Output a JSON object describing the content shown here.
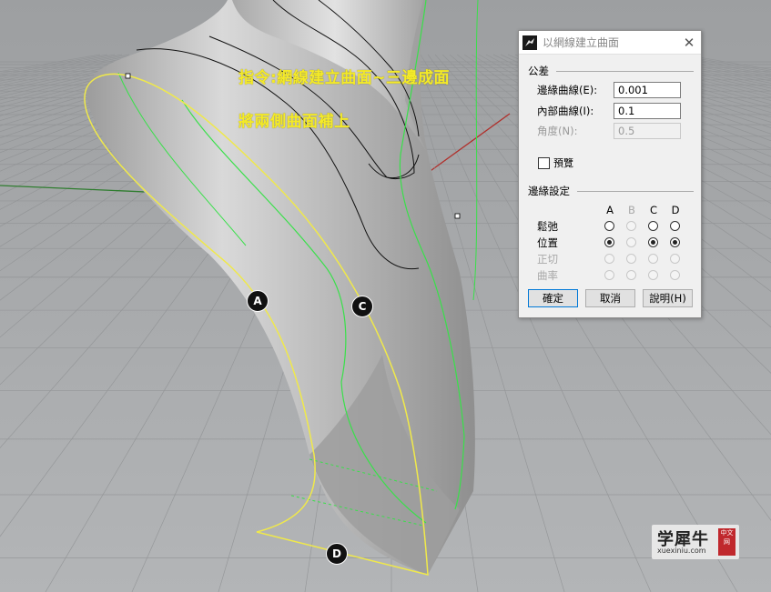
{
  "annotations": {
    "command_line": "指令:網線建立曲面~三邊成面",
    "instruction": "將兩側曲面補上"
  },
  "markers": [
    "A",
    "C",
    "D"
  ],
  "dialog": {
    "title": "以網線建立曲面",
    "close_icon": "close-icon",
    "tolerance": {
      "heading": "公差",
      "edge_label": "邊緣曲線(E):",
      "edge_value": "0.001",
      "interior_label": "內部曲線(I):",
      "interior_value": "0.1",
      "angle_label": "角度(N):",
      "angle_value": "0.5"
    },
    "preview_label": "預覽",
    "preview_checked": false,
    "edge_settings": {
      "heading": "邊緣設定",
      "columns": [
        "A",
        "B",
        "C",
        "D"
      ],
      "rows": [
        {
          "label": "鬆弛",
          "enabled": true
        },
        {
          "label": "位置",
          "enabled": true
        },
        {
          "label": "正切",
          "enabled": false
        },
        {
          "label": "曲率",
          "enabled": false
        }
      ],
      "selected": {
        "A": "位置",
        "B": null,
        "C": "位置",
        "D": "位置"
      }
    },
    "buttons": {
      "ok": "確定",
      "cancel": "取消",
      "help": "說明(H)"
    }
  },
  "watermark": {
    "main": "学犀牛",
    "sub": "xuexiniu.com",
    "seal": "中文网"
  },
  "colors": {
    "viewport_bg": "#a9abad",
    "grid": "#9a9c9e",
    "annotation": "#f4ea2a",
    "selected_edge": "#f0e94a",
    "green_curve": "#39e04a",
    "surface": "#c9c9c9"
  }
}
